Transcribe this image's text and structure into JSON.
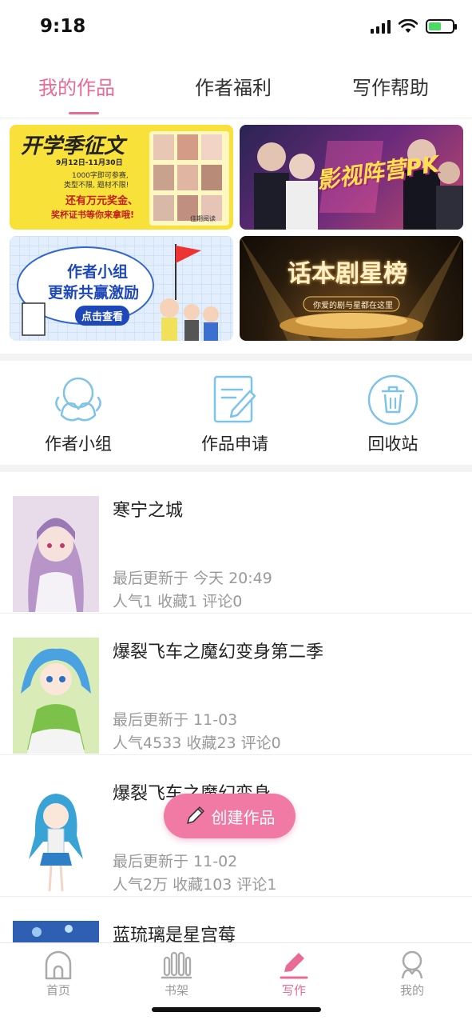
{
  "status": {
    "time": "9:18"
  },
  "tabs": [
    {
      "label": "我的作品",
      "active": true
    },
    {
      "label": "作者福利",
      "active": false
    },
    {
      "label": "写作帮助",
      "active": false
    }
  ],
  "banners": [
    {
      "title": "开学季征文",
      "dates": "9月12日-11月30日",
      "lines": [
        "1000字即可参赛,",
        "类型不限, 题材不限!",
        "还有万元奖金、",
        "奖杯证书等你来拿哦!"
      ],
      "brand": "佳期阅读"
    },
    {
      "title": "影视阵营PK"
    },
    {
      "title_line1": "作者小组",
      "title_line2": "更新共赢激励",
      "button": "点击查看"
    },
    {
      "title": "话本剧星榜",
      "subtitle": "你爱的剧与星都在这里"
    }
  ],
  "quick_actions": [
    {
      "label": "作者小组",
      "icon": "group-icon"
    },
    {
      "label": "作品申请",
      "icon": "edit-document-icon"
    },
    {
      "label": "回收站",
      "icon": "trash-icon"
    }
  ],
  "works": [
    {
      "title": "寒宁之城",
      "updated": "最后更新于 今天 20:49",
      "stats": "人气1 收藏1 评论0"
    },
    {
      "title": "爆裂飞车之魔幻变身第二季",
      "updated": "最后更新于 11-03",
      "stats": "人气4533 收藏23 评论0"
    },
    {
      "title": "爆裂飞车之魔幻变身",
      "updated": "最后更新于 11-02",
      "stats": "人气2万 收藏103 评论1"
    },
    {
      "title": "蓝琉璃是星宫莓",
      "updated": "",
      "stats": ""
    }
  ],
  "create_button": {
    "label": "创建作品"
  },
  "bottom_nav": [
    {
      "label": "首页",
      "icon": "home-icon",
      "active": false
    },
    {
      "label": "书架",
      "icon": "bookshelf-icon",
      "active": false
    },
    {
      "label": "写作",
      "icon": "pen-icon",
      "active": true
    },
    {
      "label": "我的",
      "icon": "profile-icon",
      "active": false
    }
  ],
  "colors": {
    "accent": "#e86b93",
    "create_button": "#f07aa3",
    "secondary_text": "#999999",
    "icon_blue": "#7ec3e8"
  }
}
